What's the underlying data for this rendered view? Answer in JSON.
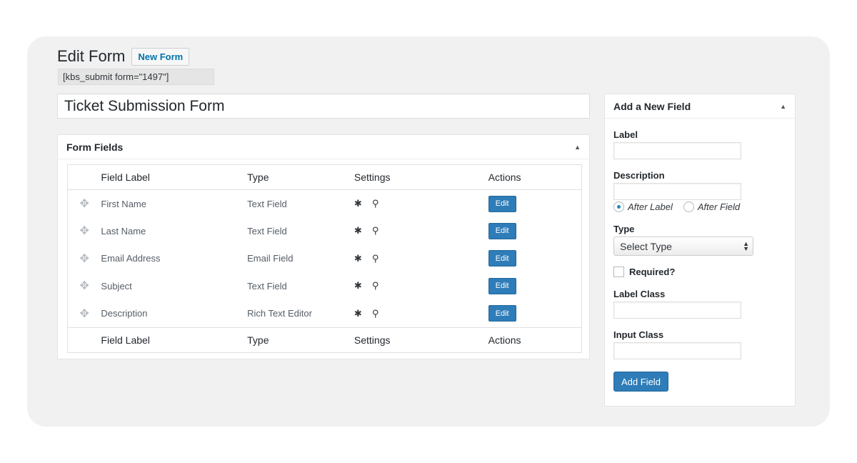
{
  "page": {
    "heading": "Edit Form",
    "new_form_label": "New Form",
    "shortcode": "[kbs_submit form=\"1497\"]",
    "form_title": "Ticket Submission Form"
  },
  "form_fields": {
    "title": "Form Fields",
    "columns": [
      "Field Label",
      "Type",
      "Settings",
      "Actions"
    ],
    "rows": [
      {
        "label": "First Name",
        "type": "Text Field",
        "action": "Edit"
      },
      {
        "label": "Last Name",
        "type": "Text Field",
        "action": "Edit"
      },
      {
        "label": "Email Address",
        "type": "Email Field",
        "action": "Edit"
      },
      {
        "label": "Subject",
        "type": "Text Field",
        "action": "Edit"
      },
      {
        "label": "Description",
        "type": "Rich Text Editor",
        "action": "Edit"
      }
    ],
    "row_setting_icons": [
      "asterisk-icon",
      "map-pin-icon"
    ],
    "drag_icon": "move-icon"
  },
  "new_field": {
    "title": "Add a New Field",
    "label_label": "Label",
    "label_value": "",
    "description_label": "Description",
    "description_value": "",
    "position_options": [
      "After Label",
      "After Field"
    ],
    "position_selected": "After Label",
    "type_label": "Type",
    "type_selected": "Select Type",
    "required_label": "Required?",
    "required_checked": false,
    "label_class_label": "Label Class",
    "label_class_value": "",
    "input_class_label": "Input Class",
    "input_class_value": "",
    "submit_label": "Add Field"
  },
  "colors": {
    "frame_bg": "#f1f1f1",
    "primary_button": "#2e7cb8",
    "link": "#0073aa"
  }
}
